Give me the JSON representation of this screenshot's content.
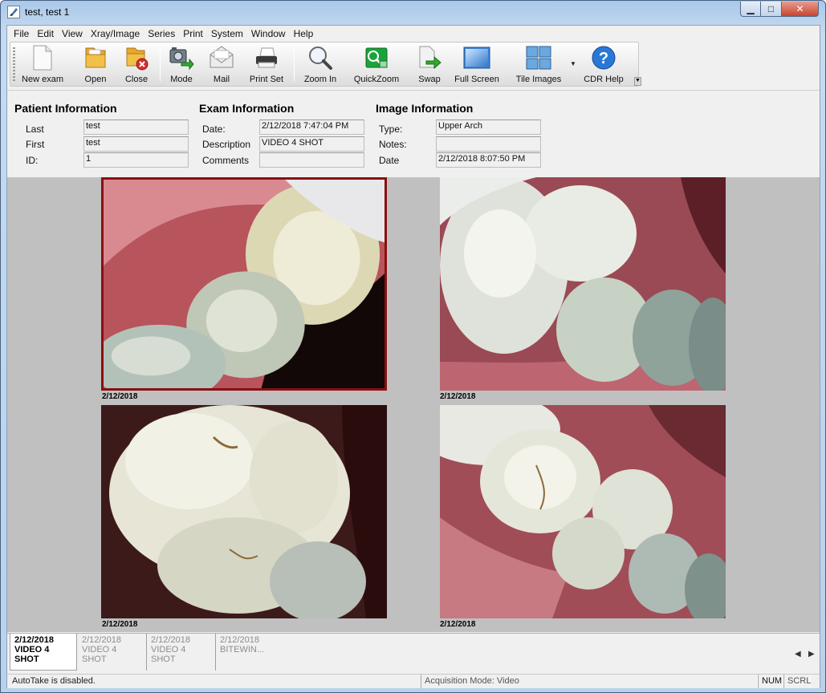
{
  "window": {
    "title": "test, test 1",
    "minimize": "▁",
    "maximize": "□",
    "close": "✕"
  },
  "menu": [
    "File",
    "Edit",
    "View",
    "Xray/Image",
    "Series",
    "Print",
    "System",
    "Window",
    "Help"
  ],
  "toolbar": [
    {
      "label": "New exam",
      "icon": "new-document-icon"
    },
    {
      "label": "Open",
      "icon": "open-folder-icon"
    },
    {
      "label": "Close",
      "icon": "close-folder-icon"
    },
    {
      "label": "Mode",
      "icon": "camera-mode-icon"
    },
    {
      "label": "Mail",
      "icon": "mail-icon"
    },
    {
      "label": "Print Set",
      "icon": "printer-icon"
    },
    {
      "label": "Zoom In",
      "icon": "magnifier-icon"
    },
    {
      "label": "QuickZoom",
      "icon": "quickzoom-icon"
    },
    {
      "label": "Swap",
      "icon": "swap-icon"
    },
    {
      "label": "Full Screen",
      "icon": "full-screen-icon"
    },
    {
      "label": "Tile Images",
      "icon": "tile-images-icon"
    },
    {
      "label": "CDR Help",
      "icon": "help-icon"
    }
  ],
  "patient": {
    "heading": "Patient Information",
    "last_label": "Last",
    "last_value": "test",
    "first_label": "First",
    "first_value": "test",
    "id_label": "ID:",
    "id_value": "1"
  },
  "exam": {
    "heading": "Exam Information",
    "date_label": "Date:",
    "date_value": "2/12/2018 7:47:04 PM",
    "description_label": "Description",
    "description_value": "VIDEO 4 SHOT",
    "comments_label": "Comments",
    "comments_value": ""
  },
  "image": {
    "heading": "Image Information",
    "type_label": "Type:",
    "type_value": "Upper Arch",
    "notes_label": "Notes:",
    "notes_value": "",
    "date_label": "Date",
    "date_value": "2/12/2018 8:07:50 PM"
  },
  "images": [
    {
      "caption": "2/12/2018",
      "selected": true
    },
    {
      "caption": "2/12/2018",
      "selected": false
    },
    {
      "caption": "2/12/2018",
      "selected": false
    },
    {
      "caption": "2/12/2018",
      "selected": false
    }
  ],
  "thumbnails": [
    {
      "date": "2/12/2018",
      "label": "VIDEO 4 SHOT",
      "active": true
    },
    {
      "date": "2/12/2018",
      "label": "VIDEO 4 SHOT",
      "active": false
    },
    {
      "date": "2/12/2018",
      "label": "VIDEO 4 SHOT",
      "active": false
    },
    {
      "date": "2/12/2018",
      "label": "BITEWIN...",
      "active": false
    }
  ],
  "thumb_nav": {
    "prev": "◀",
    "next": "▶"
  },
  "status": {
    "autotake": "AutoTake is disabled.",
    "mode": "Acquisition Mode: Video",
    "num": "NUM",
    "scrl": "SCRL"
  },
  "colors": {
    "selected_border": "#8a0f0f",
    "viewer_bg": "#c0c0c0"
  }
}
